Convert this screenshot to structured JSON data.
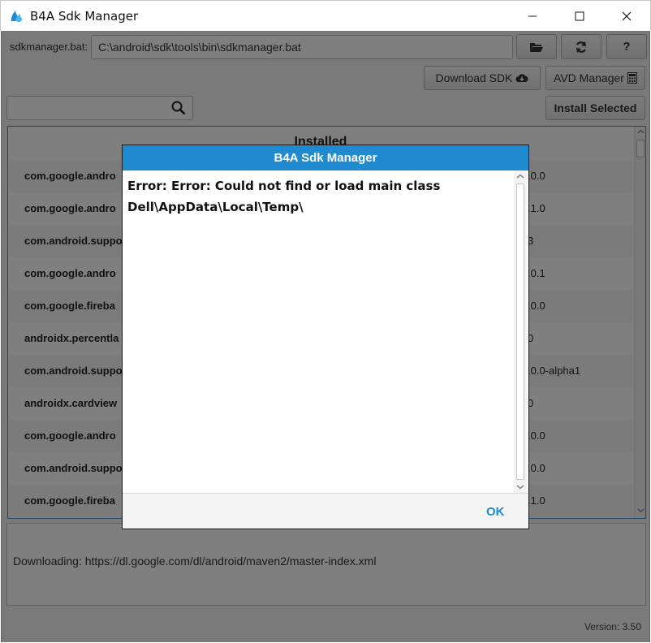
{
  "window": {
    "title": "B4A Sdk Manager"
  },
  "toolbar": {
    "sdk_label": "sdkmanager.bat:",
    "sdk_path": "C:\\android\\sdk\\tools\\bin\\sdkmanager.bat",
    "help_label": "?"
  },
  "actions": {
    "download_label": "Download SDK",
    "avd_label": "AVD Manager",
    "install_label": "Install Selected"
  },
  "search": {
    "value": ""
  },
  "list": {
    "header": "Installed",
    "rows": [
      {
        "name": "com.google.andro",
        "version": ".0.0"
      },
      {
        "name": "com.google.andro",
        "version": ".1.0"
      },
      {
        "name": "com.android.suppo",
        "version": "3"
      },
      {
        "name": "com.google.andro",
        "version": ".0.1"
      },
      {
        "name": "com.google.fireba",
        "version": ".0.0"
      },
      {
        "name": "androidx.percentla",
        "version": "0"
      },
      {
        "name": "com.android.suppo",
        "version": ".0.0-alpha1"
      },
      {
        "name": "androidx.cardview",
        "version": "0"
      },
      {
        "name": "com.google.andro",
        "version": ".0.0"
      },
      {
        "name": "com.android.suppo",
        "version": ".0.0"
      },
      {
        "name": "com.google.fireba",
        "version": ".1.0"
      }
    ]
  },
  "status": {
    "text": "Downloading: https://dl.google.com/dl/android/maven2/master-index.xml"
  },
  "footer": {
    "version": "Version: 3.50"
  },
  "dialog": {
    "title": "B4A Sdk Manager",
    "line1": "Error: Error: Could not find or load main class",
    "line2": "Dell\\AppData\\Local\\Temp\\",
    "ok_label": "OK"
  },
  "colors": {
    "accent": "#1f8ad0",
    "selection_border": "#3a8dd0"
  }
}
